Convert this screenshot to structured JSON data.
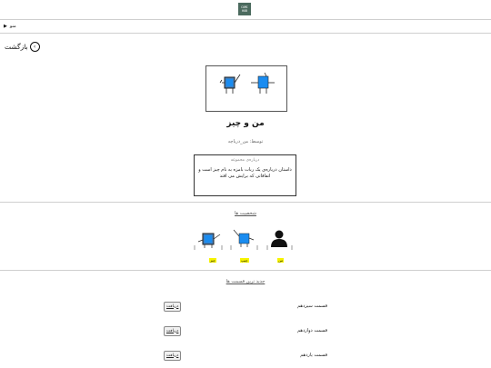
{
  "logo": {
    "line1": "COMI",
    "line2": "HUB"
  },
  "menu": {
    "label": "منو",
    "arrow": "▶"
  },
  "back": {
    "label": "بازگشت",
    "icon": "‹"
  },
  "comic": {
    "title": "من و چیز",
    "author": "توسط: من_دریاچه"
  },
  "about": {
    "heading": "درباره‌ی مجموعه",
    "text": "داستان درباره‌ی یک ربات بامزه به نام چیز است و اتفاقاتی که برایش می افتد"
  },
  "characters": {
    "heading": "شخصیت ها",
    "items": [
      {
        "label": "من"
      },
      {
        "label": "چیپ"
      },
      {
        "label": "چیز"
      }
    ]
  },
  "episodes": {
    "heading": "جدید ترین قسمت ها",
    "download_label": "دریافت",
    "items": [
      {
        "title": "قسمت سیزدهم"
      },
      {
        "title": "قسمت دوازدهم"
      },
      {
        "title": "قسمت یازدهم"
      }
    ]
  },
  "colors": {
    "robot_blue": "#1a8cf0",
    "highlight": "#f7f400",
    "logo_bg": "#4b6a5e"
  }
}
